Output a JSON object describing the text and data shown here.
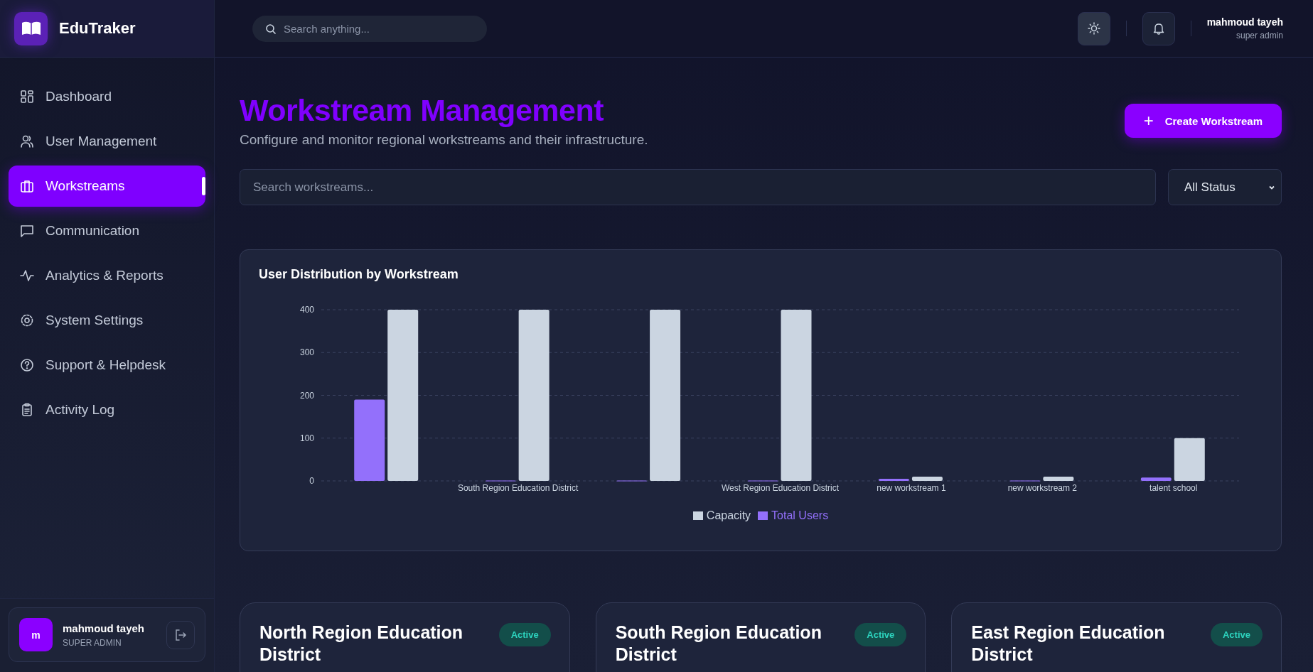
{
  "app": {
    "name": "EduTraker"
  },
  "topbar": {
    "search": {
      "placeholder": "Search anything..."
    },
    "user": {
      "name": "mahmoud tayeh",
      "role": "super admin"
    }
  },
  "sidebar": {
    "items": [
      {
        "label": "Dashboard",
        "selected": false
      },
      {
        "label": "User Management",
        "selected": false
      },
      {
        "label": "Workstreams",
        "selected": true
      },
      {
        "label": "Communication",
        "selected": false
      },
      {
        "label": "Analytics & Reports",
        "selected": false
      },
      {
        "label": "System Settings",
        "selected": false
      },
      {
        "label": "Support & Helpdesk",
        "selected": false
      },
      {
        "label": "Activity Log",
        "selected": false
      }
    ],
    "user": {
      "initial": "m",
      "name": "mahmoud tayeh",
      "role": "SUPER ADMIN"
    }
  },
  "page": {
    "title": "Workstream Management",
    "subtitle": "Configure and monitor regional workstreams and their infrastructure.",
    "create_button": "+",
    "create_label": "Create Workstream"
  },
  "filters": {
    "search": {
      "placeholder": "Search workstreams..."
    },
    "status": {
      "value": "All Status"
    }
  },
  "chart_card": {
    "title": "User Distribution by Workstream",
    "chart_data": {
      "type": "bar",
      "categories": [
        null,
        "South Region Education District",
        null,
        "West Region Education District",
        "new workstream 1",
        "new workstream 2",
        "talent school"
      ],
      "series": [
        {
          "name": "Total Users",
          "color": "#9370fb",
          "values": [
            190,
            1,
            1,
            1,
            5,
            1,
            8
          ]
        },
        {
          "name": "Capacity",
          "color": "#cbd5e1",
          "values": [
            400,
            400,
            400,
            400,
            10,
            10,
            100
          ]
        }
      ],
      "ylim": [
        0,
        400
      ],
      "yticks": [
        0,
        100,
        200,
        300,
        400
      ],
      "grid": true,
      "legend": true
    }
  },
  "cards": [
    {
      "title": "North Region Education District",
      "status": "Active",
      "kind": "active"
    },
    {
      "title": "South Region Education District",
      "status": "Active",
      "kind": "active"
    },
    {
      "title": "East Region Education District",
      "status": "Active",
      "kind": "active"
    }
  ]
}
